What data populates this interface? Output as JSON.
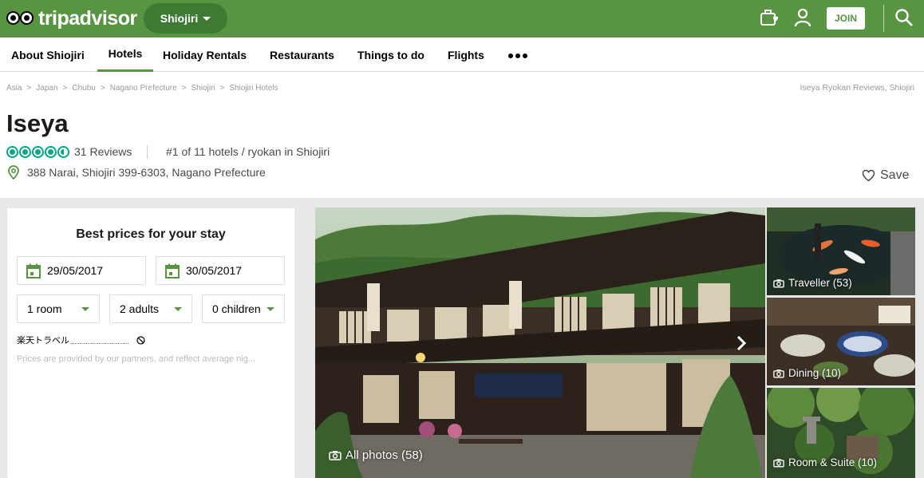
{
  "header": {
    "logo_text": "tripadvisor",
    "geo": "Shiojiri",
    "join_label": "JOIN",
    "icons": [
      "trips-icon",
      "user-icon",
      "search-icon"
    ]
  },
  "nav": {
    "items": [
      "About Shiojiri",
      "Hotels",
      "Holiday Rentals",
      "Restaurants",
      "Things to do",
      "Flights"
    ],
    "active": "Hotels"
  },
  "breadcrumb": {
    "items": [
      "Asia",
      "Japan",
      "Chubu",
      "Nagano Prefecture",
      "Shiojiri",
      "Shiojiri Hotels"
    ],
    "separator": ">",
    "right": "Iseya Ryokan Reviews, Shiojiri"
  },
  "hotel": {
    "name": "Iseya",
    "rating": 4.5,
    "reviews": "31 Reviews",
    "rank": "#1 of 11 hotels / ryokan in Shiojiri",
    "address": "388 Narai, Shiojiri 399-6303, Nagano Prefecture",
    "save_label": "Save"
  },
  "booking": {
    "title": "Best prices for your stay",
    "checkin": "29/05/2017",
    "checkout": "30/05/2017",
    "rooms": "1 room",
    "adults": "2 adults",
    "children": "0 children",
    "partner": "楽天トラベル",
    "disclaimer": "Prices are provided by our partners, and reflect average nig..."
  },
  "photos": {
    "main_label": "All photos (58)",
    "thumbs": [
      {
        "label": "Traveller (53)"
      },
      {
        "label": "Dining (10)"
      },
      {
        "label": "Room & Suite (10)"
      }
    ]
  },
  "colors": {
    "brand_green": "#589442",
    "pill_green": "#3f7a34",
    "bubble_green": "#00a680"
  }
}
